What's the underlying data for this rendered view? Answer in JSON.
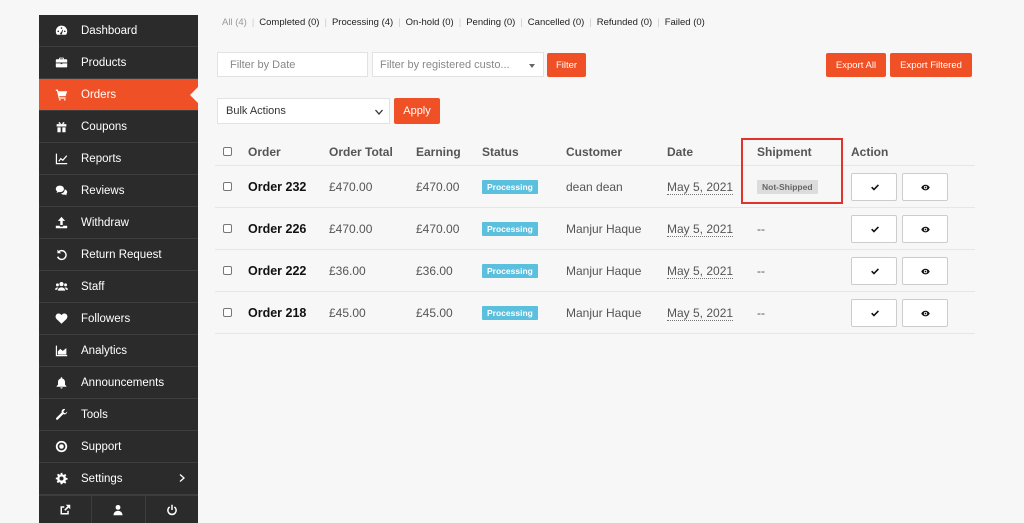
{
  "sidebar": {
    "items": [
      {
        "label": "Dashboard",
        "icon": "dashboard-icon",
        "active": false
      },
      {
        "label": "Products",
        "icon": "briefcase-icon",
        "active": false
      },
      {
        "label": "Orders",
        "icon": "cart-icon",
        "active": true
      },
      {
        "label": "Coupons",
        "icon": "gift-icon",
        "active": false
      },
      {
        "label": "Reports",
        "icon": "line-chart-icon",
        "active": false
      },
      {
        "label": "Reviews",
        "icon": "comments-icon",
        "active": false
      },
      {
        "label": "Withdraw",
        "icon": "upload-icon",
        "active": false
      },
      {
        "label": "Return Request",
        "icon": "undo-icon",
        "active": false
      },
      {
        "label": "Staff",
        "icon": "users-icon",
        "active": false
      },
      {
        "label": "Followers",
        "icon": "heart-icon",
        "active": false
      },
      {
        "label": "Analytics",
        "icon": "area-chart-icon",
        "active": false
      },
      {
        "label": "Announcements",
        "icon": "bell-icon",
        "active": false
      },
      {
        "label": "Tools",
        "icon": "wrench-icon",
        "active": false
      },
      {
        "label": "Support",
        "icon": "lifebuoy-icon",
        "active": false
      },
      {
        "label": "Settings",
        "icon": "gear-icon",
        "active": false
      }
    ],
    "footer_icons": [
      "external-link-icon",
      "user-icon",
      "power-icon"
    ]
  },
  "status_filters": [
    {
      "label": "All (4)",
      "muted": true
    },
    {
      "label": "Completed (0)",
      "muted": false
    },
    {
      "label": "Processing (4)",
      "muted": false
    },
    {
      "label": "On-hold (0)",
      "muted": false
    },
    {
      "label": "Pending (0)",
      "muted": false
    },
    {
      "label": "Cancelled (0)",
      "muted": false
    },
    {
      "label": "Refunded (0)",
      "muted": false
    },
    {
      "label": "Failed (0)",
      "muted": false
    }
  ],
  "filters": {
    "date_placeholder": "Filter by Date",
    "customer_placeholder": "Filter by registered custo...",
    "filter_button": "Filter",
    "export_all": "Export All",
    "export_filtered": "Export Filtered",
    "bulk_actions": "Bulk Actions",
    "apply": "Apply"
  },
  "table": {
    "headers": {
      "order": "Order",
      "total": "Order Total",
      "earning": "Earning",
      "status": "Status",
      "customer": "Customer",
      "date": "Date",
      "shipment": "Shipment",
      "action": "Action"
    },
    "rows": [
      {
        "order": "Order 232",
        "total": "£470.00",
        "earning": "£470.00",
        "status": "Processing",
        "customer": "dean dean",
        "date": "May 5, 2021",
        "shipment": "Not-Shipped"
      },
      {
        "order": "Order 226",
        "total": "£470.00",
        "earning": "£470.00",
        "status": "Processing",
        "customer": "Manjur Haque",
        "date": "May 5, 2021",
        "shipment": "--"
      },
      {
        "order": "Order 222",
        "total": "£36.00",
        "earning": "£36.00",
        "status": "Processing",
        "customer": "Manjur Haque",
        "date": "May 5, 2021",
        "shipment": "--"
      },
      {
        "order": "Order 218",
        "total": "£45.00",
        "earning": "£45.00",
        "status": "Processing",
        "customer": "Manjur Haque",
        "date": "May 5, 2021",
        "shipment": "--"
      }
    ]
  },
  "colors": {
    "accent": "#f05025",
    "sidebar_bg": "#2b2b2b",
    "status_badge": "#5bc0de",
    "highlight_border": "#e0332b"
  }
}
